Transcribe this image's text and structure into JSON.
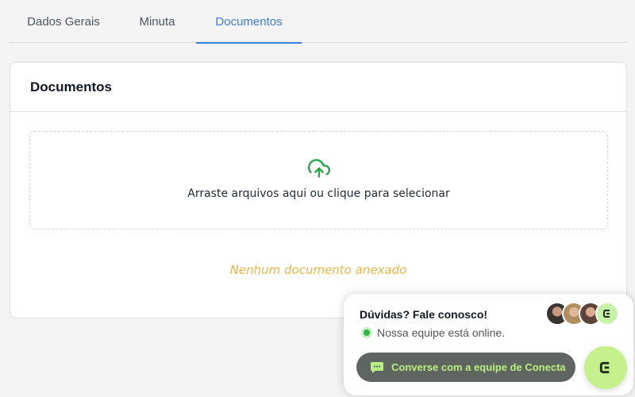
{
  "tabs": [
    {
      "label": "Dados Gerais",
      "active": false
    },
    {
      "label": "Minuta",
      "active": false
    },
    {
      "label": "Documentos",
      "active": true
    }
  ],
  "card": {
    "title": "Documentos",
    "dropzone_text": "Arraste arquivos aqui ou clique para selecionar",
    "upload_icon": "cloud-upload-icon",
    "empty_message": "Nenhum documento anexado"
  },
  "chat": {
    "title": "Dúvidas? Fale conosco!",
    "status": "Nossa equipe está online.",
    "button_label": "Converse com a equipe de Conecta",
    "button_icon": "chat-bubble-icon"
  },
  "colors": {
    "active_tab": "#3b7dd8",
    "empty_message": "#f0b440",
    "online": "#2fb344",
    "chat_accent": "#b8f07f",
    "fab_bg": "#c4f18c"
  }
}
